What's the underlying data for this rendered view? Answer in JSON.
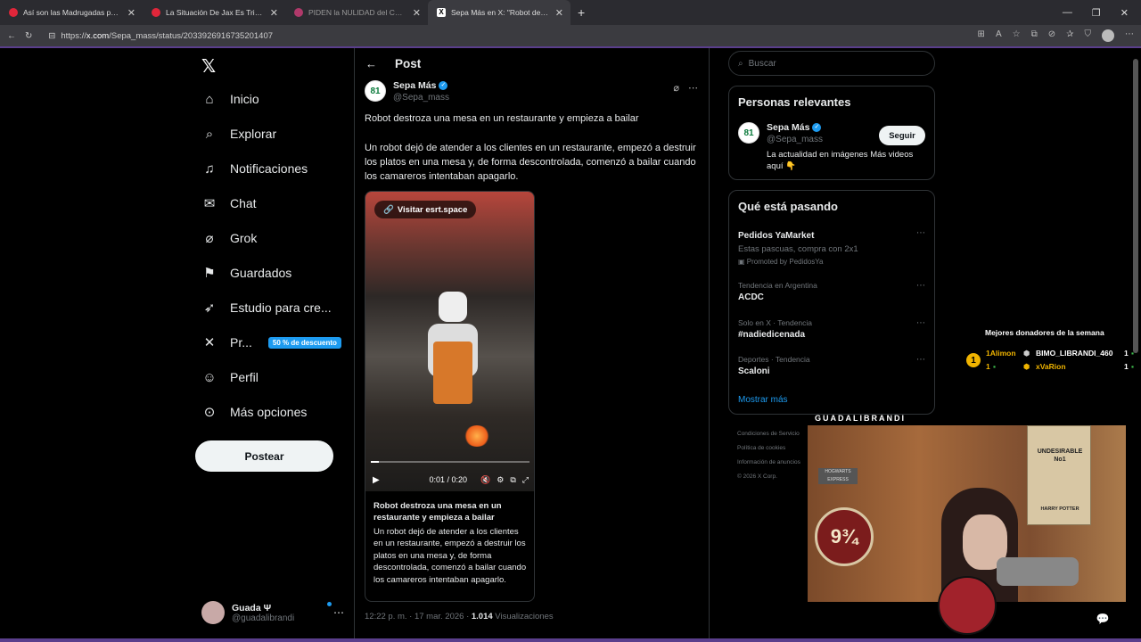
{
  "browser": {
    "tabs": [
      {
        "title": "Así son las Madrugadas por el barrio"
      },
      {
        "title": "La Situación De Jax Es Triste - YouTube"
      },
      {
        "title": "PIDEN la NULIDAD del CASO Fernando"
      },
      {
        "title": "Sepa Más en X: \"Robot destroza una mesa\""
      }
    ],
    "url_prefix": "https://",
    "url_host": "x.com",
    "url_path": "/Sepa_mass/status/2033926916735201407"
  },
  "nav": {
    "items": [
      {
        "label": "Inicio",
        "icon": "home-icon"
      },
      {
        "label": "Explorar",
        "icon": "search-icon"
      },
      {
        "label": "Notificaciones",
        "icon": "bell-icon"
      },
      {
        "label": "Chat",
        "icon": "mail-icon"
      },
      {
        "label": "Grok",
        "icon": "grok-icon"
      },
      {
        "label": "Guardados",
        "icon": "bookmark-icon"
      },
      {
        "label": "Estudio para cre...",
        "icon": "rocket-icon"
      },
      {
        "label": "Pr...",
        "icon": "x-icon"
      },
      {
        "label": "Perfil",
        "icon": "person-icon"
      },
      {
        "label": "Más opciones",
        "icon": "more-circle-icon"
      }
    ],
    "premium_badge": "50 % de descuento",
    "post_button": "Postear",
    "account": {
      "name": "Guada Ψ",
      "handle": "@guadalibrandi"
    }
  },
  "post": {
    "header": "Post",
    "author": {
      "name": "Sepa Más",
      "handle": "@Sepa_mass",
      "avatar_text": "81"
    },
    "title": "Robot destroza una mesa en un restaurante y empieza a bailar",
    "body": "Un robot dejó de atender a los clientes en un restaurante, empezó a destruir los platos en una mesa y, de forma descontrolada, comenzó a bailar cuando los camareros intentaban apagarlo.",
    "video": {
      "visit_label": "Visitar esrt.space",
      "time": "0:01 / 0:20",
      "progress": 0.05
    },
    "card_title": "Robot destroza una mesa en un restaurante y empieza a bailar",
    "card_desc": "Un robot dejó de atender a los clientes en un restaurante, empezó a destruir los platos en una mesa y, de forma descontrolada, comenzó a bailar cuando los camareros intentaban apagarlo.",
    "timestamp": "12:22 p. m. · 17 mar. 2026 · ",
    "views_count": "1.014",
    "views_label": "Visualizaciones"
  },
  "sidebar": {
    "search_placeholder": "Buscar",
    "relevant_title": "Personas relevantes",
    "relevant": {
      "name": "Sepa Más",
      "handle": "@Sepa_mass",
      "bio": "La actualidad en imágenes Más videos aquí 👇",
      "follow": "Seguir"
    },
    "trending_title": "Qué está pasando",
    "trends": [
      {
        "context": "",
        "name": "Pedidos YaMarket",
        "sub": "Estas pascuas, compra con 2x1",
        "promo": "Promoted by PedidosYa"
      },
      {
        "context": "Tendencia en Argentina",
        "name": "ACDC",
        "sub": "",
        "promo": ""
      },
      {
        "context": "Solo en X · Tendencia",
        "name": "#nadiedicenada",
        "sub": "",
        "promo": ""
      },
      {
        "context": "Deportes · Tendencia",
        "name": "Scaloni",
        "sub": "",
        "promo": ""
      }
    ],
    "show_more": "Mostrar más",
    "footer": [
      "Condiciones de Servicio",
      "Política de cookies",
      "Información de anuncios",
      "© 2026 X Corp."
    ]
  },
  "stream": {
    "donors_title": "Mejores donadores de la semana",
    "donor_rank": "1",
    "donors": [
      {
        "name": "1Alimon",
        "count": "1"
      },
      {
        "name": "BIMO_LIBRANDI_460",
        "count": "1"
      },
      {
        "name": "xVaRion",
        "count": "1"
      }
    ],
    "streamer_name": "GUADALIBRANDI",
    "poster_title": "UNDESIRABLE No1",
    "poster_caption": "HARRY POTTER",
    "platform": "9¾",
    "platform_label": "HOGWARTS EXPRESS"
  },
  "colors": {
    "accent": "#1d9bf0",
    "bg": "#000000",
    "border": "#2f3336",
    "muted": "#71767b"
  }
}
